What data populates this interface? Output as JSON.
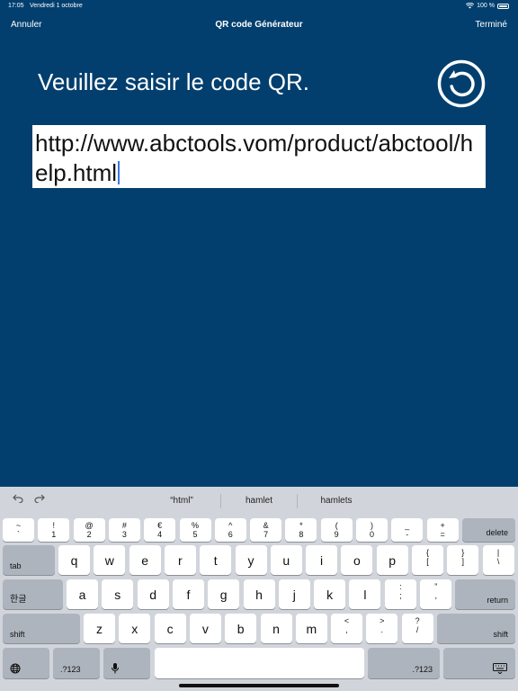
{
  "status_bar": {
    "time": "17:05",
    "date": "Vendredi 1 octobre",
    "battery": "100 %"
  },
  "nav": {
    "cancel": "Annuler",
    "title": "QR code Générateur",
    "done": "Terminé"
  },
  "main": {
    "prompt": "Veuillez saisir le code QR.",
    "input_value": "http://www.abctools.vom/product/abctool/help.html",
    "reset_icon": "reset-icon"
  },
  "keyboard": {
    "suggestions": [
      "“html”",
      "hamlet",
      "hamlets"
    ],
    "row1": [
      {
        "top": "~",
        "bot": "`"
      },
      {
        "top": "!",
        "bot": "1"
      },
      {
        "top": "@",
        "bot": "2"
      },
      {
        "top": "#",
        "bot": "3"
      },
      {
        "top": "€",
        "bot": "4"
      },
      {
        "top": "%",
        "bot": "5"
      },
      {
        "top": "^",
        "bot": "6"
      },
      {
        "top": "&",
        "bot": "7"
      },
      {
        "top": "*",
        "bot": "8"
      },
      {
        "top": "(",
        "bot": "9"
      },
      {
        "top": ")",
        "bot": "0"
      },
      {
        "top": "_",
        "bot": "-"
      },
      {
        "top": "+",
        "bot": "="
      }
    ],
    "delete": "delete",
    "tab": "tab",
    "row2": [
      "q",
      "w",
      "e",
      "r",
      "t",
      "y",
      "u",
      "i",
      "o",
      "p"
    ],
    "row2_sym": [
      {
        "top": "{",
        "bot": "["
      },
      {
        "top": "}",
        "bot": "]"
      },
      {
        "top": "|",
        "bot": "\\"
      }
    ],
    "lang": "한글",
    "row3": [
      "a",
      "s",
      "d",
      "f",
      "g",
      "h",
      "j",
      "k",
      "l"
    ],
    "row3_sym": [
      {
        "top": ":",
        "bot": ";"
      },
      {
        "top": "”",
        "bot": ","
      }
    ],
    "return": "return",
    "shift": "shift",
    "row4": [
      "z",
      "x",
      "c",
      "v",
      "b",
      "n",
      "m"
    ],
    "row4_sym": [
      {
        "top": "<",
        "bot": ","
      },
      {
        "top": ">",
        "bot": "."
      },
      {
        "top": "?",
        "bot": "/"
      }
    ],
    "numbers": ".?123"
  }
}
